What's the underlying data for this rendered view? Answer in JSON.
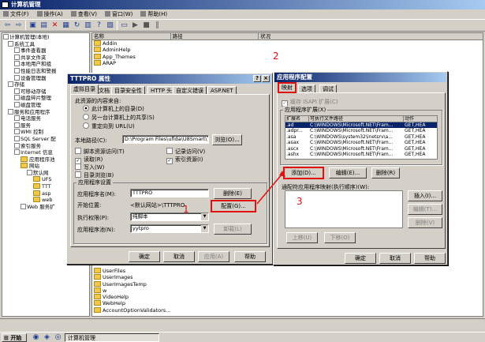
{
  "main_window": {
    "title": "计算机管理",
    "menu": [
      "文件(F)",
      "操作(A)",
      "查看(V)",
      "窗口(W)",
      "帮助(H)"
    ],
    "tree": [
      "计算机管理(本地)",
      "系统工具",
      "事件查看器",
      "共享文件夹",
      "本地用户和组",
      "性能日志和警报",
      "设备管理器",
      "存储",
      "可移动存储",
      "磁盘碎片整理",
      "磁盘管理",
      "服务和应用程序",
      "电话服务",
      "服务",
      "WMI 控制",
      "SQL Server 配",
      "索引服务",
      "Internet 信息",
      "应用程序池",
      "网站",
      "默认网",
      "UFS",
      "TTT",
      "asp",
      "web",
      "Web 服务扩"
    ],
    "list_headers": [
      "名称",
      "路径",
      "状况"
    ],
    "list_items_top": [
      "Addin",
      "AdminHelp",
      "App_Themes",
      "ARAP"
    ],
    "list_items_bottom": [
      "UserFiles",
      "UserImages",
      "UserImagesTemp",
      "w",
      "VideoHelp",
      "WebHelp",
      "AccountOptionValidators..."
    ]
  },
  "props_dialog": {
    "title": "TTTPRO 属性",
    "tabs": [
      "虚拟目录",
      "文档",
      "目录安全性",
      "HTTP 头",
      "自定义错误",
      "ASP.NET"
    ],
    "source_label": "此资源的内容来自:",
    "radio_options": [
      "此计算机上的目录(D)",
      "另一台计算机上的共享(S)",
      "重定向到 URL(U)"
    ],
    "local_path_label": "本地路径(C):",
    "local_path_value": "D:\\Program Files\\ufida\\U8Smart\\T",
    "browse_label": "浏览(O)...",
    "checkboxes": [
      "脚本资源访问(T)",
      "读取(R)",
      "写入(W)",
      "目录浏览(B)"
    ],
    "checkboxes_right": [
      "记录访问(V)",
      "索引资源(I)"
    ],
    "app_settings_label": "应用程序设置",
    "app_name_label": "应用程序名(M):",
    "app_name_value": "TTTPRO",
    "remove_label": "删除(E)",
    "start_pos_label": "开始位置:",
    "start_pos_value": "<默认网站>\\TTTPRO",
    "config_label": "配置(G)...",
    "exec_perm_label": "执行权限(P):",
    "exec_perm_value": "纯脚本",
    "app_pool_label": "应用程序池(N):",
    "app_pool_value": "yytpro",
    "unload_label": "卸载(L)",
    "buttons": [
      "确定",
      "取消",
      "应用(A)",
      "帮助"
    ]
  },
  "config_dialog": {
    "title": "应用程序配置",
    "tabs": [
      "映射",
      "选项",
      "调试"
    ],
    "cache_label": "缓存 ISAPI 扩展(C)",
    "ext_group_label": "应用程序扩展(X)",
    "ext_headers": [
      "扩展名",
      "可执行文件路径",
      "动作"
    ],
    "ext_rows": [
      [
        ".ad",
        "C:\\WINDOWS\\Microsoft.NET\\Fram...",
        "GET,HEA"
      ],
      [
        ".adpr...",
        "C:\\WINDOWS\\Microsoft.NET\\Fram...",
        "GET,HEA"
      ],
      [
        ".asa",
        "C:\\WINDOWS\\system32\\inetsrv\\a...",
        "GET,HEA"
      ],
      [
        ".asax",
        "C:\\WINDOWS\\Microsoft.NET\\Fram...",
        "GET,HEA"
      ],
      [
        ".ascx",
        "C:\\WINDOWS\\Microsoft.NET\\Fram...",
        "GET,HEA"
      ],
      [
        ".ashx",
        "C:\\WINDOWS\\Microsoft.NET\\Fram...",
        "GET,HEA"
      ]
    ],
    "add_label": "添加(D)...",
    "edit_label": "编辑(E)...",
    "delete_label": "删除(R)",
    "wildcard_label": "通配符应用程序映射(执行顺序)(W):",
    "insert_label": "插入(I)...",
    "edit2_label": "编辑(T)...",
    "remove2_label": "删除(V)",
    "moveup_label": "上移(U)",
    "movedown_label": "下移(O)",
    "buttons": [
      "确定",
      "取消",
      "帮助"
    ]
  },
  "annotations": [
    "1",
    "2",
    "3"
  ],
  "taskbar": {
    "start_label": "开始",
    "task_label": "计算机管理"
  }
}
